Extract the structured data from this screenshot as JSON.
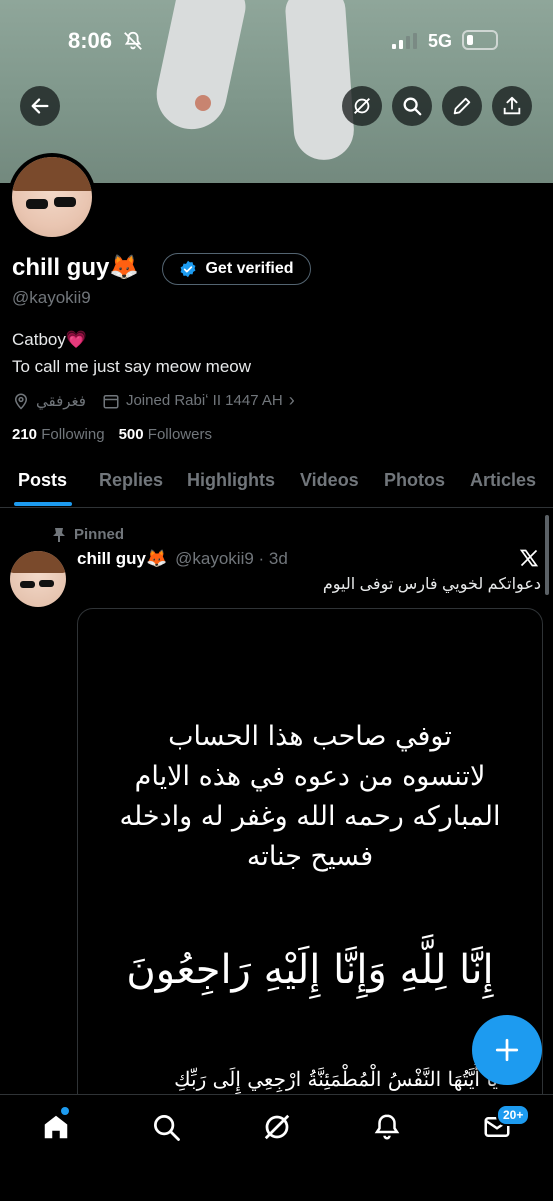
{
  "status_bar": {
    "time": "8:06",
    "network": "5G"
  },
  "profile": {
    "display_name": "chill guy",
    "name_emoji": "🦊",
    "handle": "@kayokii9",
    "verify_label": "Get verified",
    "bio_line1": "Catboy",
    "bio_emoji": "💗",
    "bio_line2": "To call me just say meow meow",
    "location": "فغرفقي",
    "joined": "Joined Rabiʻ II 1447 AH",
    "following_count": "210",
    "following_label": "Following",
    "followers_count": "500",
    "followers_label": "Followers"
  },
  "tabs": [
    "Posts",
    "Replies",
    "Highlights",
    "Videos",
    "Photos",
    "Articles"
  ],
  "post": {
    "pinned_label": "Pinned",
    "author": "chill guy",
    "author_emoji": "🦊",
    "handle_time": "@kayokii9 · 3d",
    "text": "دعواتكم لخويي فارس توفى اليوم",
    "image_lines": [
      "توفي صاحب هذا الحساب",
      "لاتنسوه من دعوه في هذه الايام",
      "المباركه رحمه الله وغفر له وادخله",
      "فسيح جناته"
    ],
    "image_verse": "إِنَّا لِلَّهِ وَإِنَّا إِلَيْهِ رَاجِعُونَ",
    "image_verse2": "يَا أَيَّتُهَا النَّفْسُ الْمُطْمَئِنَّةُ ارْجِعِي إِلَى رَبِّكِ"
  },
  "nav": {
    "messages_badge": "20+"
  },
  "colors": {
    "accent": "#1d9bf0",
    "background": "#000000",
    "muted": "#71767b"
  }
}
